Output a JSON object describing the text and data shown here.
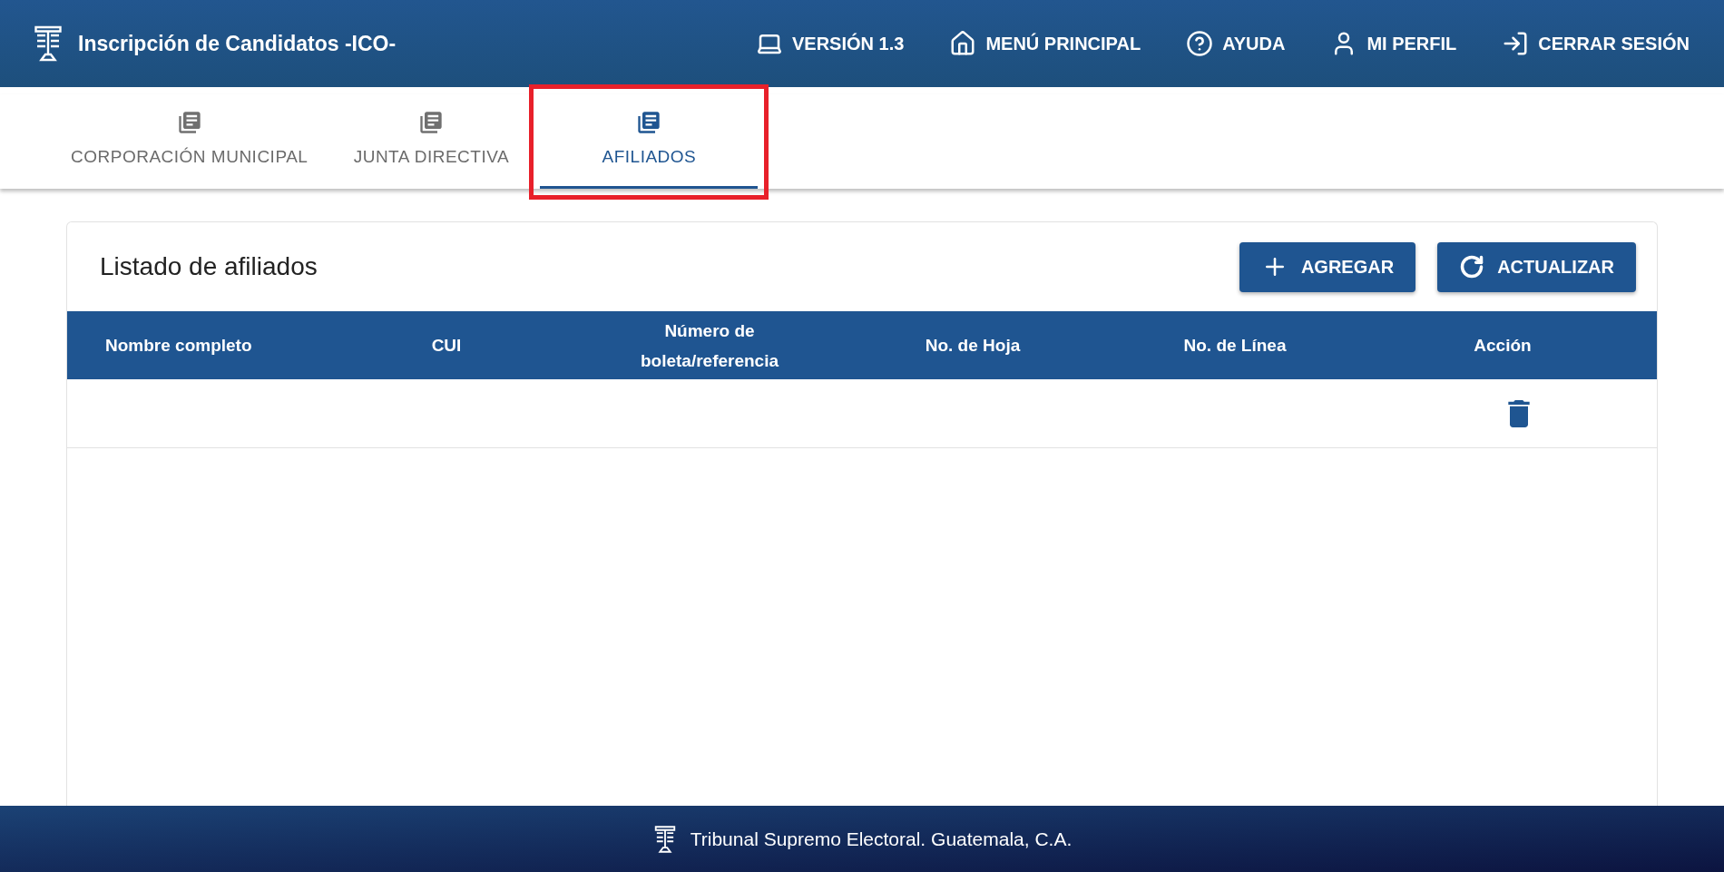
{
  "header": {
    "title": "Inscripción de Candidatos -ICO-",
    "nav": [
      {
        "kind": "laptop",
        "label": "VERSIÓN 1.3"
      },
      {
        "kind": "home",
        "label": "MENÚ PRINCIPAL"
      },
      {
        "kind": "help",
        "label": "AYUDA"
      },
      {
        "kind": "user",
        "label": "MI PERFIL"
      },
      {
        "kind": "logout",
        "label": "CERRAR SESIÓN"
      }
    ]
  },
  "tabs": [
    {
      "label": "CORPORACIÓN MUNICIPAL",
      "selected": false,
      "highlighted": false
    },
    {
      "label": "JUNTA DIRECTIVA",
      "selected": false,
      "highlighted": false
    },
    {
      "label": "AFILIADOS",
      "selected": true,
      "highlighted": true
    }
  ],
  "card": {
    "title": "Listado de afiliados",
    "buttons": [
      {
        "kind": "add",
        "label": "AGREGAR"
      },
      {
        "kind": "refresh",
        "label": "ACTUALIZAR"
      }
    ]
  },
  "table": {
    "columns": [
      "Nombre completo",
      "CUI",
      "Número de boleta/referencia",
      "No. de Hoja",
      "No. de Línea",
      "Acción"
    ],
    "rows": [
      {
        "cells": [
          "",
          "",
          "",
          "",
          ""
        ],
        "delete": true
      }
    ]
  },
  "footer": {
    "text": "Tribunal Supremo Electoral. Guatemala, C.A."
  }
}
